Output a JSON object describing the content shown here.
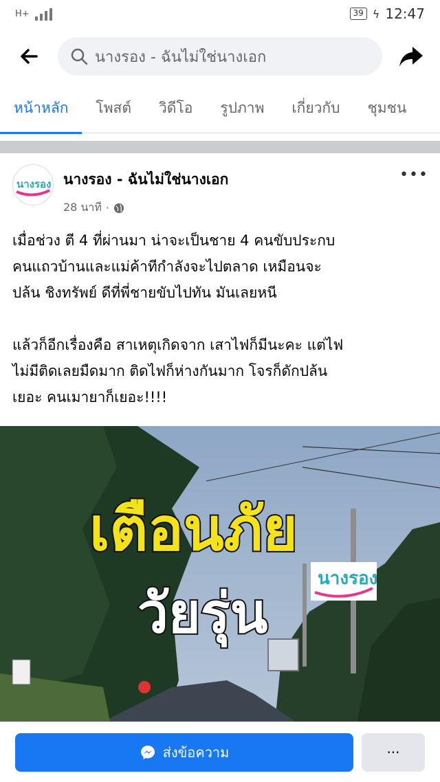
{
  "status_bar": {
    "network": "H+",
    "battery": "39",
    "time": "12:47"
  },
  "search": {
    "query": "นางรอง - ฉันไม่ใช่นางเอก"
  },
  "tabs": [
    {
      "label": "หน้าหลัก"
    },
    {
      "label": "โพสต์"
    },
    {
      "label": "วิดีโอ"
    },
    {
      "label": "รูปภาพ"
    },
    {
      "label": "เกี่ยวกับ"
    },
    {
      "label": "ชุมชน"
    }
  ],
  "post": {
    "page_name": "นางรอง - ฉันไม่ใช่นางเอก",
    "time": "28 นาที",
    "text": "เมื่อช่วง ตี 4 ที่ผ่านมา น่าจะเป็นชาย 4 คนขับประกบ\nคนแถวบ้านและแม่ค้าทีกำลังจะไปตลาด เหมือนจะ\nปล้น ชิงทรัพย์ ดีที่พี่ชายขับไปทัน มันเลยหนี\n\nแล้วก็อีกเรื่องคือ สาเหตุเกิดจาก เสาไฟก็มีนะคะ แต่ไฟ\nไม่มีติดเลยมืดมาก ติดไฟก็ห่างกันมาก โจรก็ดักปล้น\nเยอะ คนเมายาก็เยอะ!!!!",
    "image_line1": "เตือนภัย",
    "image_line2": "วัยรุ่น",
    "logo_text": "นางรอง"
  },
  "actions": {
    "message_label": "ส่งข้อความ",
    "more_label": "···"
  },
  "colors": {
    "accent": "#1877f2",
    "headline_yellow": "#f5e31a"
  }
}
